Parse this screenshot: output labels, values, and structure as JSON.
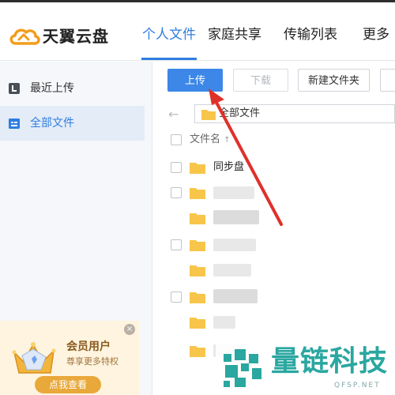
{
  "app": {
    "name": "天翼云盘"
  },
  "nav": {
    "tabs": [
      {
        "label": "个人文件",
        "active": true
      },
      {
        "label": "家庭共享",
        "active": false
      },
      {
        "label": "传输列表",
        "active": false
      },
      {
        "label": "更多",
        "active": false
      }
    ]
  },
  "sidebar": {
    "items": [
      {
        "label": "最近上传",
        "icon": "recent-icon",
        "active": false
      },
      {
        "label": "全部文件",
        "icon": "all-files-icon",
        "active": true
      }
    ],
    "promo": {
      "title": "会员用户",
      "subtitle": "尊享更多特权",
      "button": "点我查看",
      "close": "×"
    }
  },
  "toolbar": {
    "upload": "上传",
    "download": "下载",
    "new_folder": "新建文件夹"
  },
  "breadcrumb": {
    "back": "←",
    "path": "全部文件"
  },
  "file_list": {
    "column_name": "文件名",
    "sort_indicator": "↑",
    "rows": [
      {
        "name": "同步盘",
        "type": "folder"
      }
    ]
  },
  "watermark": {
    "text": "量链科技",
    "url": "QFSP.NET"
  },
  "colors": {
    "accent": "#2f7de1",
    "primary_button": "#3c87e8",
    "folder": "#f7c54a",
    "annotation_arrow": "#e0302a",
    "watermark": "#2aa7a0"
  }
}
